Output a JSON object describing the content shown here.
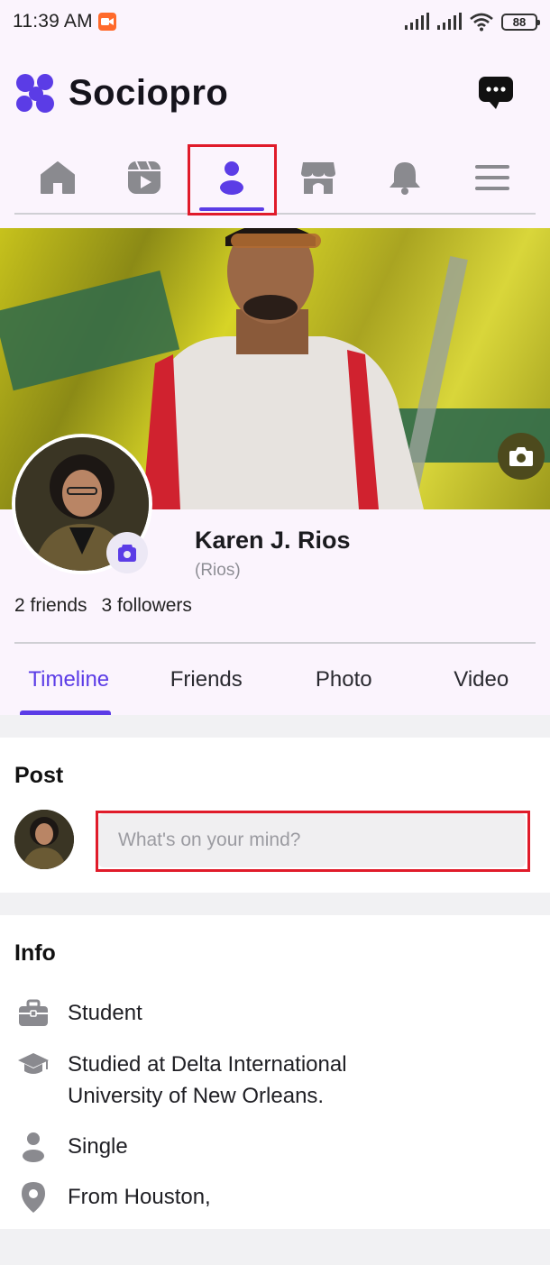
{
  "status_bar": {
    "time": "11:39 AM",
    "battery": "88"
  },
  "app": {
    "title": "Sociopro"
  },
  "nav": {
    "items": [
      {
        "name": "home"
      },
      {
        "name": "videos"
      },
      {
        "name": "profile",
        "active": true
      },
      {
        "name": "marketplace"
      },
      {
        "name": "notifications"
      },
      {
        "name": "menu"
      }
    ]
  },
  "profile": {
    "name": "Karen J. Rios",
    "nickname": "(Rios)",
    "friends": "2 friends",
    "followers": "3 followers"
  },
  "tabs": [
    {
      "label": "Timeline",
      "active": true
    },
    {
      "label": "Friends"
    },
    {
      "label": "Photo"
    },
    {
      "label": "Video"
    }
  ],
  "post": {
    "title": "Post",
    "placeholder": "What's on your mind?"
  },
  "info": {
    "title": "Info",
    "items": [
      {
        "icon": "briefcase-icon",
        "text": "Student"
      },
      {
        "icon": "graduation-cap-icon",
        "text": "Studied at Delta International University of New Orleans."
      },
      {
        "icon": "person-icon",
        "text": "Single"
      },
      {
        "icon": "location-pin-icon",
        "text": "From Houston,"
      }
    ]
  },
  "colors": {
    "accent": "#5b3ce6",
    "highlight": "#e01b2a",
    "header_bg": "#fbf4fd"
  }
}
